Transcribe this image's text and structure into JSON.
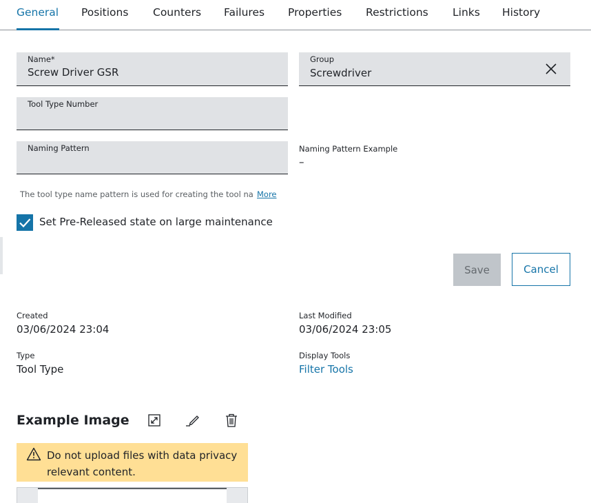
{
  "tabs": [
    {
      "label": "General",
      "active": true
    },
    {
      "label": "Positions"
    },
    {
      "label": "Counters"
    },
    {
      "label": "Failures"
    },
    {
      "label": "Properties"
    },
    {
      "label": "Restrictions"
    },
    {
      "label": "Links"
    },
    {
      "label": "History"
    }
  ],
  "form": {
    "name": {
      "label": "Name*",
      "value": "Screw Driver GSR"
    },
    "group": {
      "label": "Group",
      "value": "Screwdriver",
      "clear_icon": "close-icon"
    },
    "tool_type_number": {
      "label": "Tool Type Number",
      "value": ""
    },
    "naming_pattern": {
      "label": "Naming Pattern",
      "value": ""
    },
    "naming_pattern_example": {
      "label": "Naming Pattern Example",
      "value": "–"
    },
    "hint": "The tool type name pattern is used for creating the tool na",
    "hint_more": "More",
    "prereleased": {
      "label": "Set Pre-Released state on large maintenance",
      "checked": true
    }
  },
  "actions": {
    "save": "Save",
    "cancel": "Cancel"
  },
  "meta": {
    "created": {
      "label": "Created",
      "value": "03/06/2024 23:04"
    },
    "last_modified": {
      "label": "Last Modified",
      "value": "03/06/2024 23:05"
    },
    "type": {
      "label": "Type",
      "value": "Tool Type"
    },
    "display_tools": {
      "label": "Display Tools",
      "value": "Filter Tools"
    }
  },
  "example_image": {
    "title": "Example Image",
    "icons": [
      "expand-icon",
      "edit-icon",
      "delete-icon"
    ],
    "notice": "Do not upload files with data privacy relevant content."
  },
  "colors": {
    "accent": "#1574a8",
    "field_bg": "#e0e2e5",
    "warning_bg": "#ffdf95",
    "disabled_button": "#c0c5ca"
  }
}
